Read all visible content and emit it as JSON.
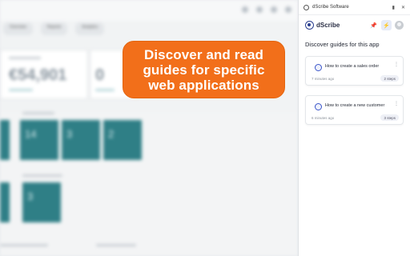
{
  "background_app": {
    "tabs": [
      "Overview",
      "Reports",
      "Analytics"
    ],
    "kpis": [
      {
        "value": "€54,901"
      },
      {
        "value": "0"
      }
    ],
    "tiles": [
      "14",
      "3",
      "2",
      "3"
    ]
  },
  "callout": {
    "text": "Discover and read guides for specific web applications",
    "color": "#f26f1a"
  },
  "panel": {
    "window_title": "dScribe Software",
    "brand_name": "dScribe",
    "section_title": "Discover guides for this app",
    "guides": [
      {
        "title": "How to create a sales order",
        "time": "7 minutes ago",
        "badge": "2 steps"
      },
      {
        "title": "How to create a new customer",
        "time": "6 minutes ago",
        "badge": "3 steps"
      }
    ],
    "icons": {
      "pin": "pin-icon",
      "notify": "lightning-icon",
      "avatar": "user-avatar-icon"
    },
    "accent_color": "#3a55c9"
  }
}
